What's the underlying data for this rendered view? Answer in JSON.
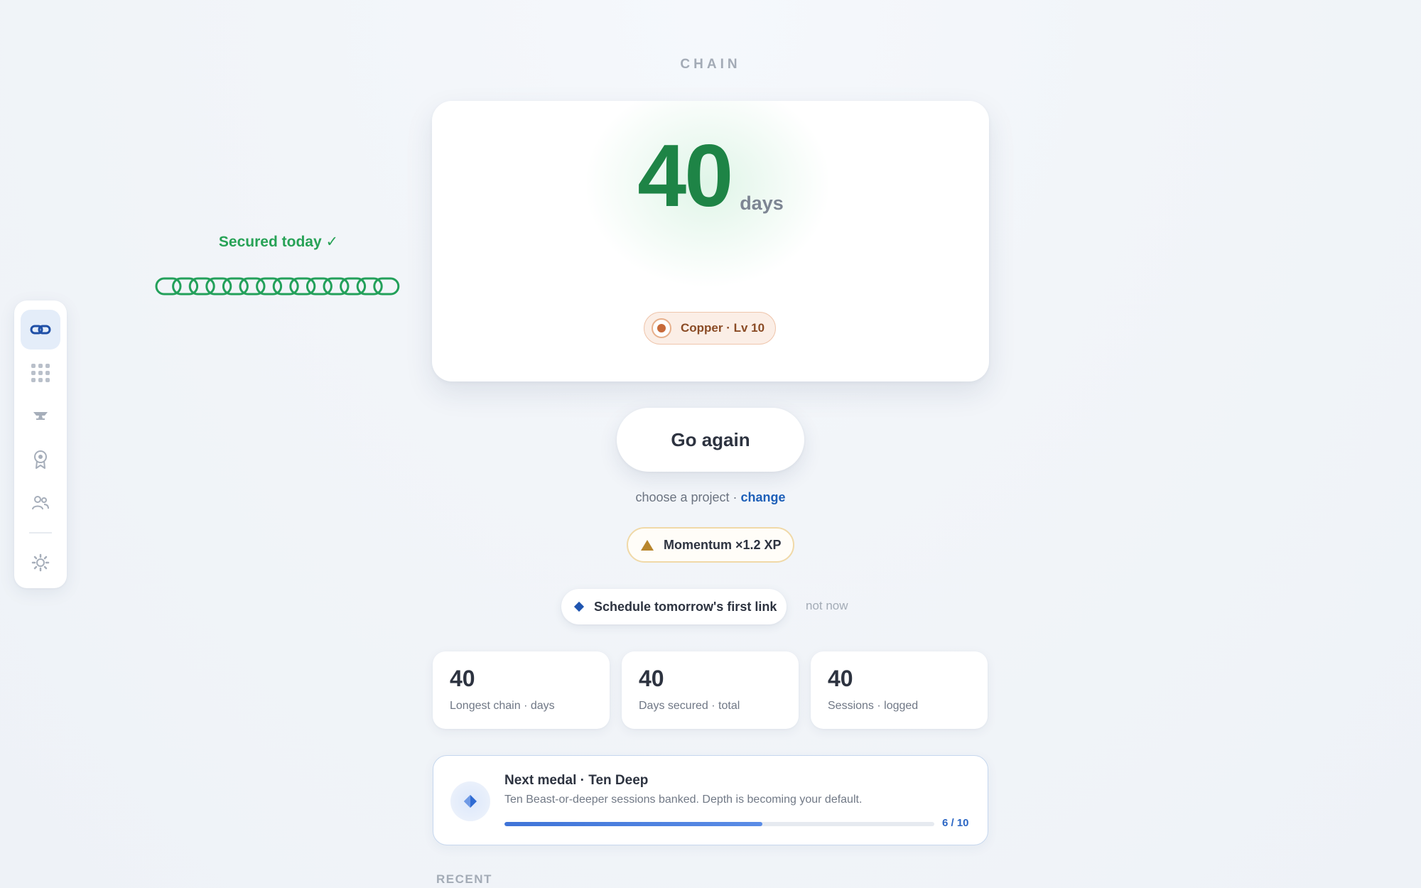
{
  "page": {
    "heading": "CHAIN"
  },
  "sidebar": {
    "items": [
      {
        "name": "chain",
        "icon": "chain-link-icon",
        "active": true
      },
      {
        "name": "grid",
        "icon": "grid-dots-icon"
      },
      {
        "name": "anvil",
        "icon": "anvil-icon"
      },
      {
        "name": "medals",
        "icon": "medal-icon"
      },
      {
        "name": "people",
        "icon": "people-icon"
      },
      {
        "name": "settings",
        "icon": "gear-icon"
      }
    ]
  },
  "hero": {
    "streak_value": "40",
    "streak_unit": "days",
    "status": "Secured today ✓",
    "chain_links": 14,
    "level_badge": "Copper · Lv 10"
  },
  "actions": {
    "go_again_label": "Go again",
    "project_text": "choose a project ·",
    "project_link": "change",
    "momentum_label": "Momentum ×1.2 XP",
    "schedule_label": "Schedule tomorrow's first link",
    "not_now_label": "not now"
  },
  "stats": [
    {
      "value": "40",
      "label": "Longest chain · days"
    },
    {
      "value": "40",
      "label": "Days secured · total"
    },
    {
      "value": "40",
      "label": "Sessions · logged"
    }
  ],
  "next_medal": {
    "title": "Next medal · Ten Deep",
    "description": "Ten Beast-or-deeper sessions banked. Depth is becoming your default.",
    "progress_current": 6,
    "progress_total": 10,
    "progress_text": "6 / 10"
  },
  "recent": {
    "heading": "RECENT"
  },
  "colors": {
    "streak_green": "#1e8446",
    "accent_blue": "#1d5fb8",
    "copper": "#c76a3a",
    "momentum_gold": "#b8862d"
  }
}
